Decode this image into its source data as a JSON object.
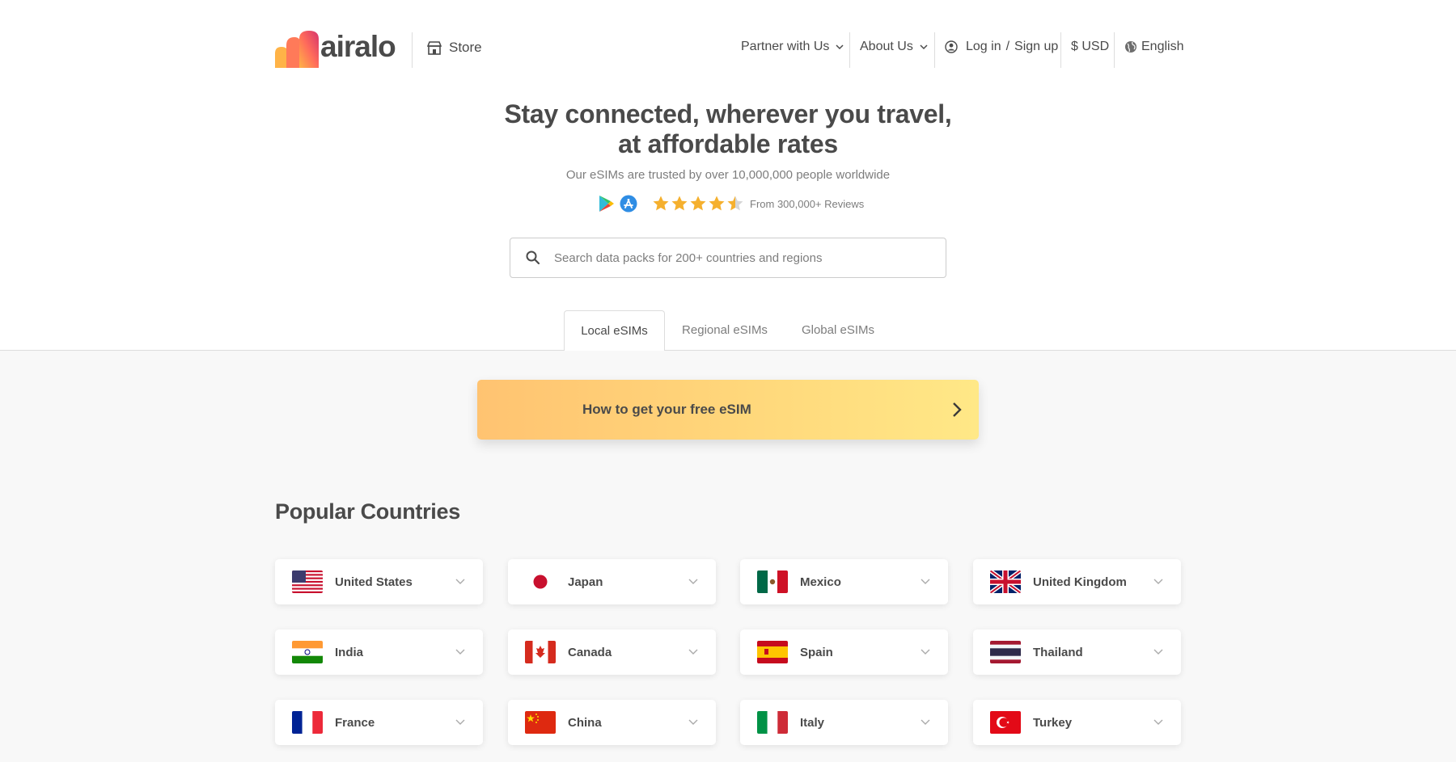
{
  "header": {
    "logo_text": "airalo",
    "store_label": "Store",
    "partner_label": "Partner with Us",
    "about_label": "About Us",
    "login_label": "Log in",
    "login_sep": "/",
    "signup_label": "Sign up",
    "currency_label": "$ USD",
    "language_label": "English"
  },
  "hero": {
    "title_line1": "Stay connected, wherever you travel,",
    "title_line2": "at affordable rates",
    "subtitle": "Our eSIMs are trusted by over 10,000,000 people worldwide",
    "rating": 4.5,
    "rating_max": 5,
    "reviews_text": "From 300,000+ Reviews"
  },
  "search": {
    "placeholder": "Search data packs for 200+ countries and regions"
  },
  "tabs": [
    {
      "label": "Local eSIMs",
      "active": true
    },
    {
      "label": "Regional eSIMs",
      "active": false
    },
    {
      "label": "Global eSIMs",
      "active": false
    }
  ],
  "banner": {
    "text": "How to get your free eSIM"
  },
  "popular": {
    "title": "Popular Countries",
    "countries": [
      {
        "name": "United States"
      },
      {
        "name": "Japan"
      },
      {
        "name": "Mexico"
      },
      {
        "name": "United Kingdom"
      },
      {
        "name": "India"
      },
      {
        "name": "Canada"
      },
      {
        "name": "Spain"
      },
      {
        "name": "Thailand"
      },
      {
        "name": "France"
      },
      {
        "name": "China"
      },
      {
        "name": "Italy"
      },
      {
        "name": "Turkey"
      }
    ]
  },
  "colors": {
    "text": "#4a4a4a",
    "muted": "#7d7d7d",
    "star": "#f5b02e",
    "banner_start": "#ffc371",
    "banner_end": "#ffe887",
    "page_bg_lower": "#f8f8f8"
  }
}
